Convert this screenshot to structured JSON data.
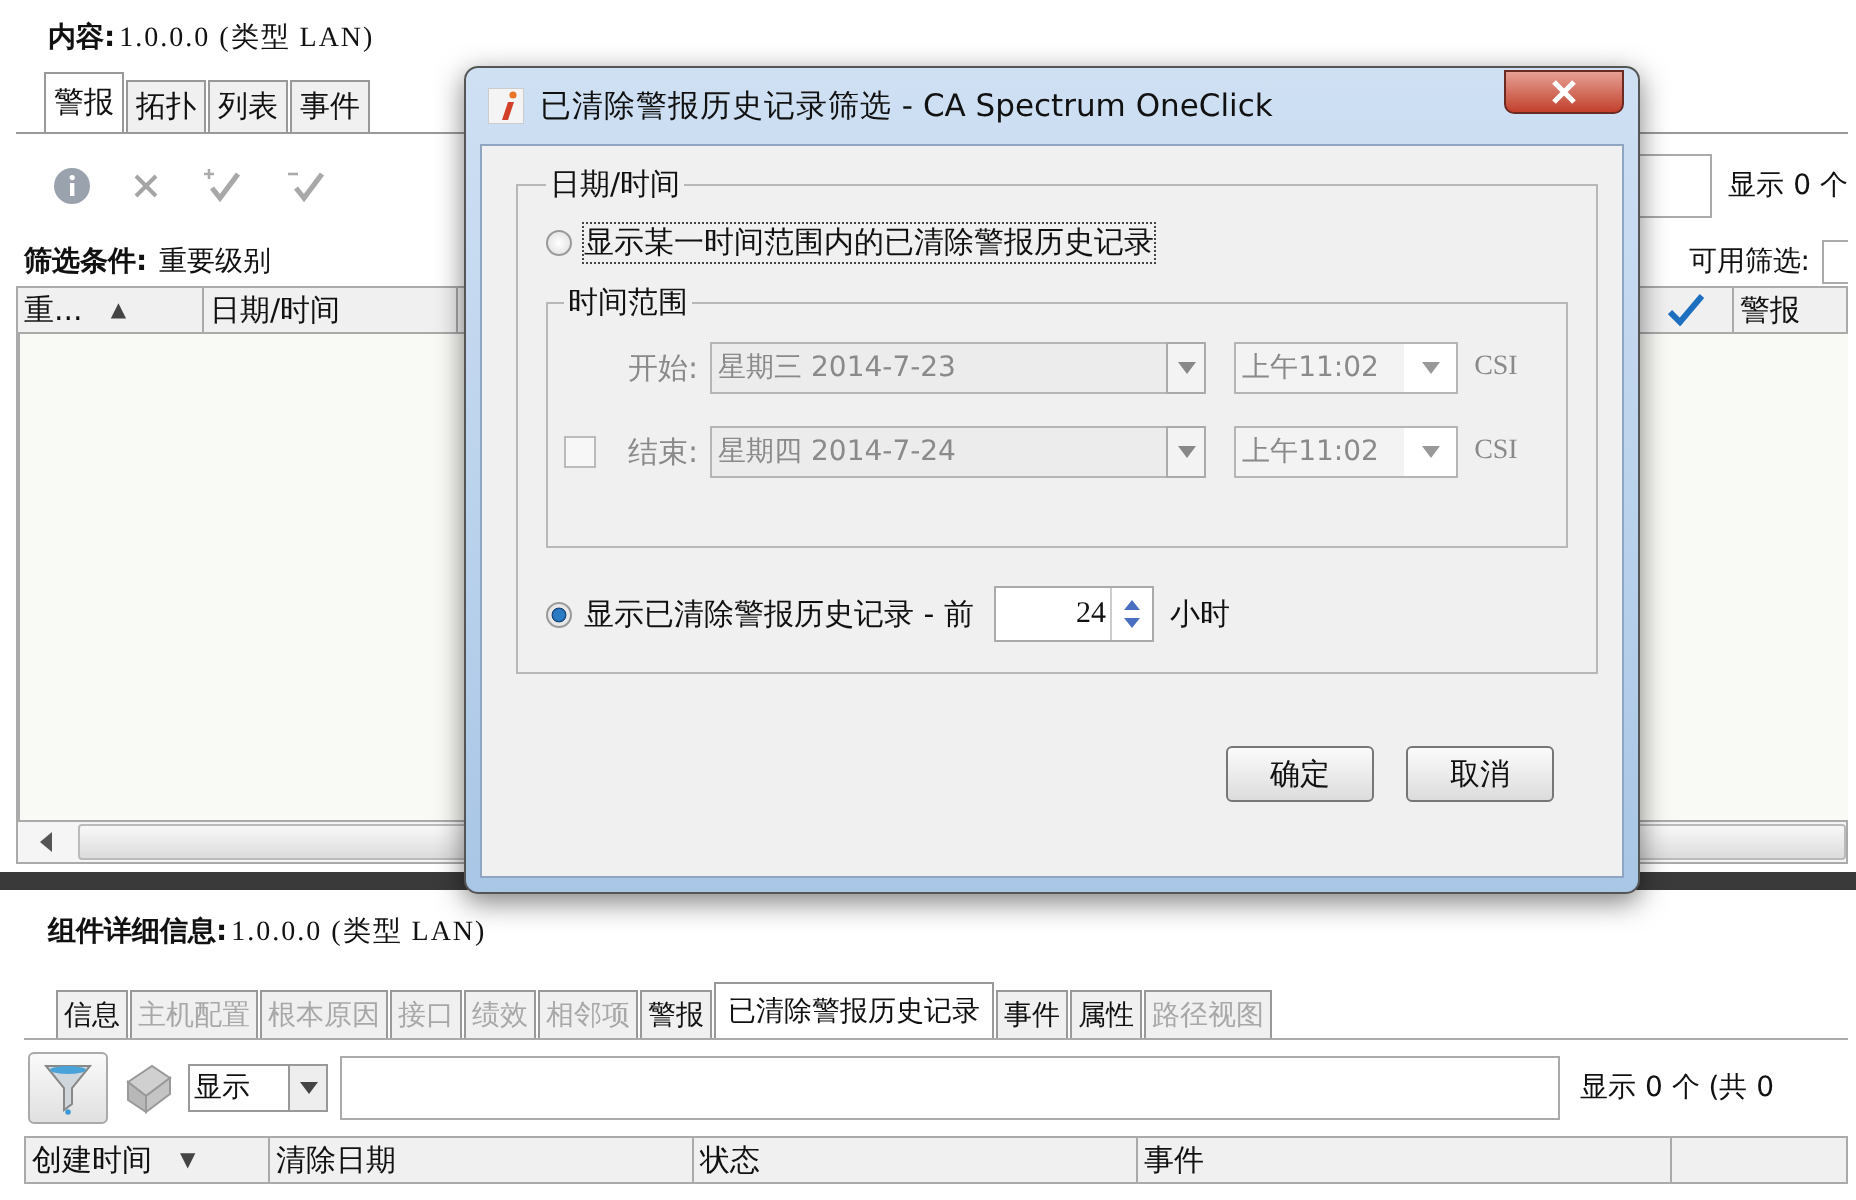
{
  "content_panel": {
    "label": "内容:",
    "value": "1.0.0.0 (类型 LAN)",
    "tabs": [
      {
        "label": "警报",
        "selected": true
      },
      {
        "label": "拓扑",
        "selected": false
      },
      {
        "label": "列表",
        "selected": false
      },
      {
        "label": "事件",
        "selected": false
      }
    ],
    "counter": "显示 0 个",
    "filter_label": "筛选条件:",
    "filter_value": "重要级别",
    "available_filters_label": "可用筛选:",
    "columns": [
      {
        "label": "重...",
        "sort_icon": "▲"
      },
      {
        "label": "日期/时间"
      }
    ],
    "right_columns": [
      {
        "kind": "check"
      },
      {
        "kind": "text",
        "label": "警报"
      }
    ]
  },
  "dialog": {
    "title": "已清除警报历史记录筛选 - CA Spectrum OneClick",
    "group_label": "日期/时间",
    "range_option": {
      "label": "显示某一时间范围内的已清除警报历史记录",
      "selected": false
    },
    "range_group": {
      "label": "时间范围",
      "disabled": true,
      "start": {
        "label": "开始:",
        "date": "星期三 2014-7-23",
        "time": "上午11:02",
        "zone": "CSI"
      },
      "end": {
        "label": "结束:",
        "checked": false,
        "date": "星期四 2014-7-24",
        "time": "上午11:02",
        "zone": "CSI"
      }
    },
    "recent_option": {
      "label": "显示已清除警报历史记录 - 前",
      "selected": true,
      "hours": "24",
      "unit": "小时"
    },
    "buttons": [
      "确定",
      "取消"
    ]
  },
  "details_panel": {
    "label": "组件详细信息:",
    "value": "1.0.0.0 (类型 LAN)",
    "tabs": [
      {
        "label": "信息",
        "selected": false,
        "disabled": false
      },
      {
        "label": "主机配置",
        "selected": false,
        "disabled": true
      },
      {
        "label": "根本原因",
        "selected": false,
        "disabled": true
      },
      {
        "label": "接口",
        "selected": false,
        "disabled": true
      },
      {
        "label": "绩效",
        "selected": false,
        "disabled": true
      },
      {
        "label": "相邻项",
        "selected": false,
        "disabled": true
      },
      {
        "label": "警报",
        "selected": false,
        "disabled": false
      },
      {
        "label": "已清除警报历史记录",
        "selected": true,
        "disabled": false
      },
      {
        "label": "事件",
        "selected": false,
        "disabled": false
      },
      {
        "label": "属性",
        "selected": false,
        "disabled": false
      },
      {
        "label": "路径视图",
        "selected": false,
        "disabled": true
      }
    ],
    "view_select": "显示",
    "counter": "显示 0 个 (共 0",
    "columns": [
      {
        "label": "创建时间",
        "sort_icon": "▼"
      },
      {
        "label": "清除日期"
      },
      {
        "label": "状态"
      },
      {
        "label": "事件"
      }
    ]
  }
}
